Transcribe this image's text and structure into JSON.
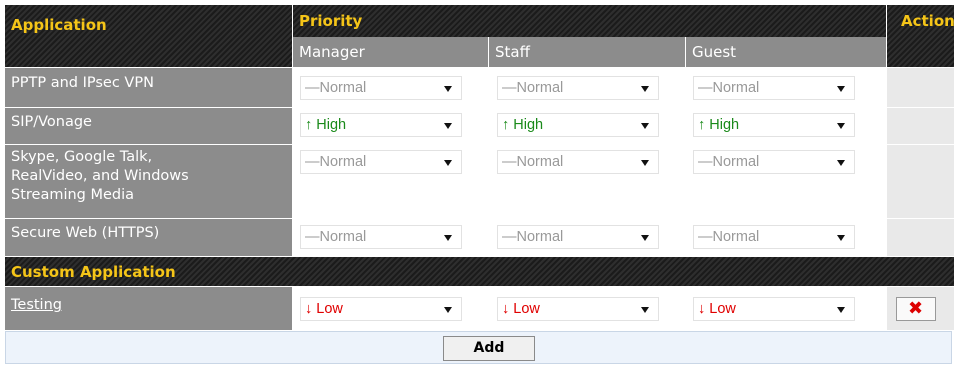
{
  "headers": {
    "application": "Application",
    "priority": "Priority",
    "action": "Action"
  },
  "priority_columns": [
    "Manager",
    "Staff",
    "Guest"
  ],
  "rows": [
    {
      "label": "PPTP and IPsec VPN",
      "values": [
        {
          "symbol": "—",
          "text": "Normal"
        },
        {
          "symbol": "—",
          "text": "Normal"
        },
        {
          "symbol": "—",
          "text": "Normal"
        }
      ]
    },
    {
      "label": "SIP/Vonage",
      "values": [
        {
          "symbol": "↑",
          "text": "High"
        },
        {
          "symbol": "↑",
          "text": "High"
        },
        {
          "symbol": "↑",
          "text": "High"
        }
      ]
    },
    {
      "label": "Skype, Google Talk, RealVideo, and Windows Streaming Media",
      "label_lines": [
        "Skype, Google Talk,",
        "RealVideo, and Windows",
        "Streaming Media"
      ],
      "values": [
        {
          "symbol": "—",
          "text": "Normal"
        },
        {
          "symbol": "—",
          "text": "Normal"
        },
        {
          "symbol": "—",
          "text": "Normal"
        }
      ]
    },
    {
      "label": "Secure Web (HTTPS)",
      "values": [
        {
          "symbol": "—",
          "text": "Normal"
        },
        {
          "symbol": "—",
          "text": "Normal"
        },
        {
          "symbol": "—",
          "text": "Normal"
        }
      ]
    }
  ],
  "custom_section": {
    "title": "Custom Application",
    "rows": [
      {
        "label": "Testing",
        "values": [
          {
            "symbol": "↓",
            "text": "Low"
          },
          {
            "symbol": "↓",
            "text": "Low"
          },
          {
            "symbol": "↓",
            "text": "Low"
          }
        ],
        "delete_icon": "close-x-icon"
      }
    ]
  },
  "add_button": "Add",
  "colors": {
    "header_text": "#f5c518",
    "normal": "#999999",
    "high": "#1a8a1a",
    "low": "#e00000",
    "delete": "#dd0000"
  }
}
